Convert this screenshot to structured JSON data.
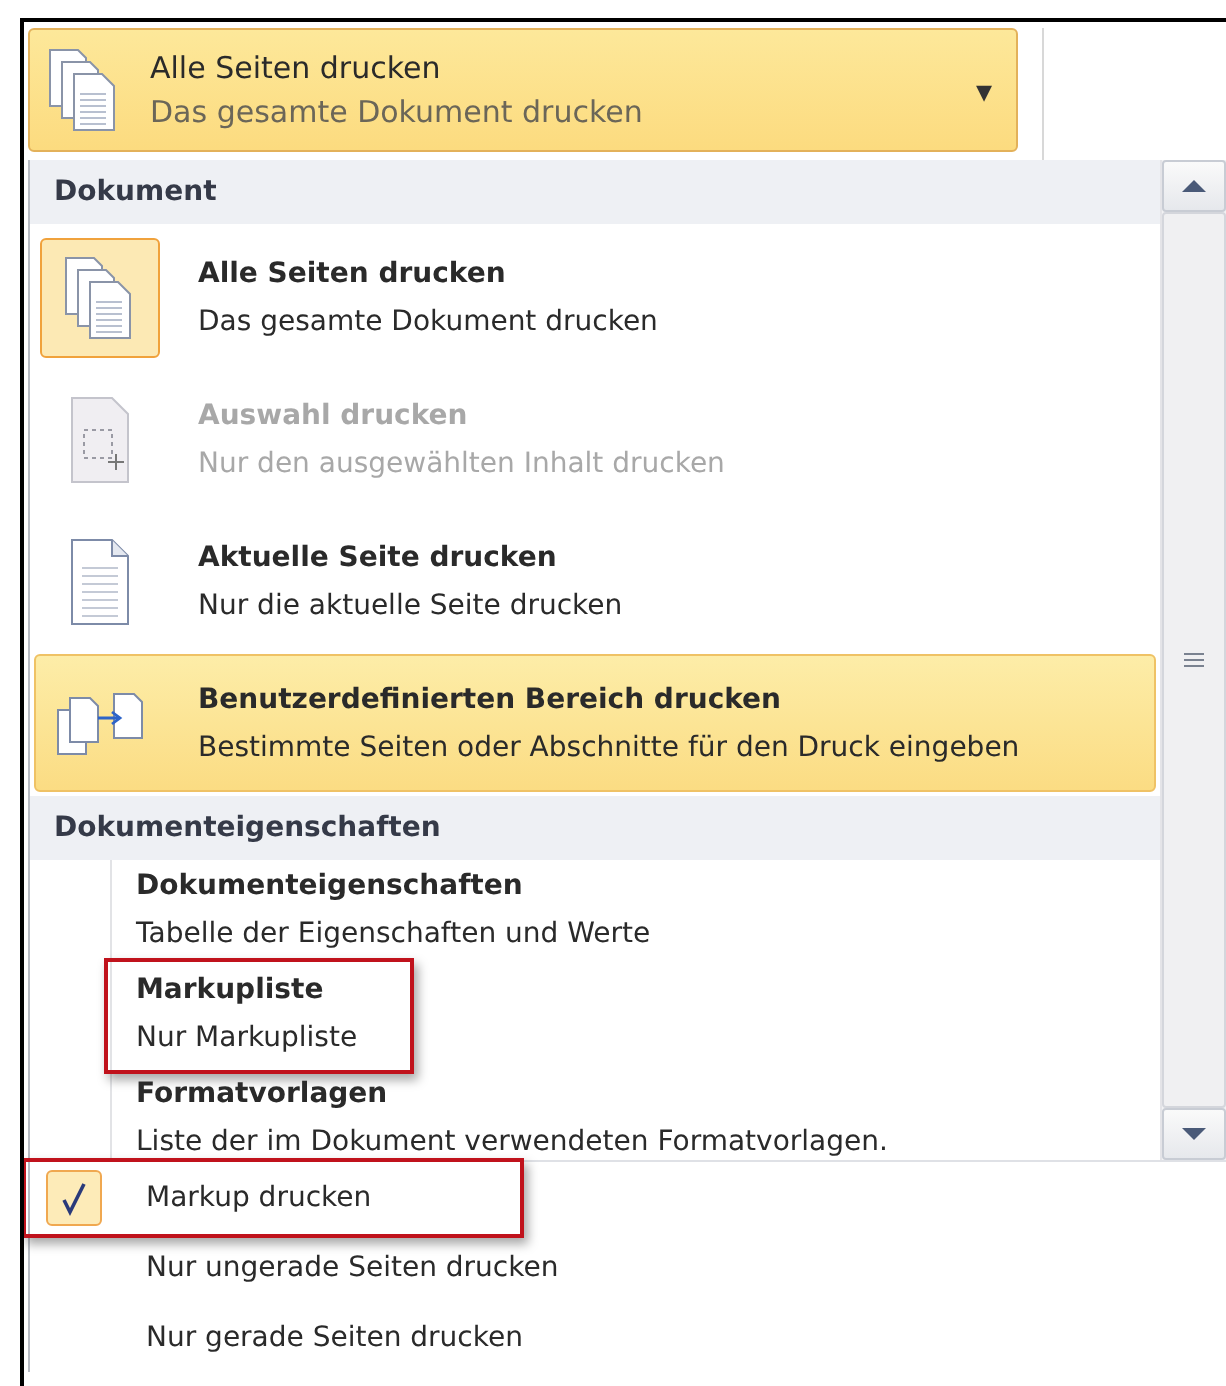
{
  "dropdown": {
    "title": "Alle Seiten drucken",
    "subtitle": "Das gesamte Dokument drucken",
    "caret": "▾"
  },
  "sections": [
    {
      "header": "Dokument",
      "kind": "icons",
      "items": [
        {
          "title": "Alle Seiten drucken",
          "description": "Das gesamte Dokument drucken",
          "selected": true,
          "hovered": false,
          "disabled": false
        },
        {
          "title": "Auswahl drucken",
          "description": "Nur den ausgewählten Inhalt drucken",
          "selected": false,
          "hovered": false,
          "disabled": true
        },
        {
          "title": "Aktuelle Seite drucken",
          "description": "Nur die aktuelle Seite drucken",
          "selected": false,
          "hovered": false,
          "disabled": false
        },
        {
          "title": "Benutzerdefinierten Bereich drucken",
          "description": "Bestimmte Seiten oder Abschnitte für den Druck eingeben",
          "selected": false,
          "hovered": true,
          "disabled": false
        }
      ]
    },
    {
      "header": "Dokumenteigenschaften",
      "kind": "plain",
      "items": [
        {
          "title": "Dokumenteigenschaften",
          "description": "Tabelle der Eigenschaften und Werte",
          "annotated": false
        },
        {
          "title": "Markupliste",
          "description": "Nur Markupliste",
          "annotated": true
        },
        {
          "title": "Formatvorlagen",
          "description": "Liste der im Dokument verwendeten Formatvorlagen.",
          "annotated": false
        }
      ]
    }
  ],
  "options": [
    {
      "label": "Markup drucken",
      "checked": true,
      "annotated": true
    },
    {
      "label": "Nur ungerade Seiten drucken",
      "checked": false,
      "annotated": false
    },
    {
      "label": "Nur gerade Seiten drucken",
      "checked": false,
      "annotated": false
    }
  ]
}
